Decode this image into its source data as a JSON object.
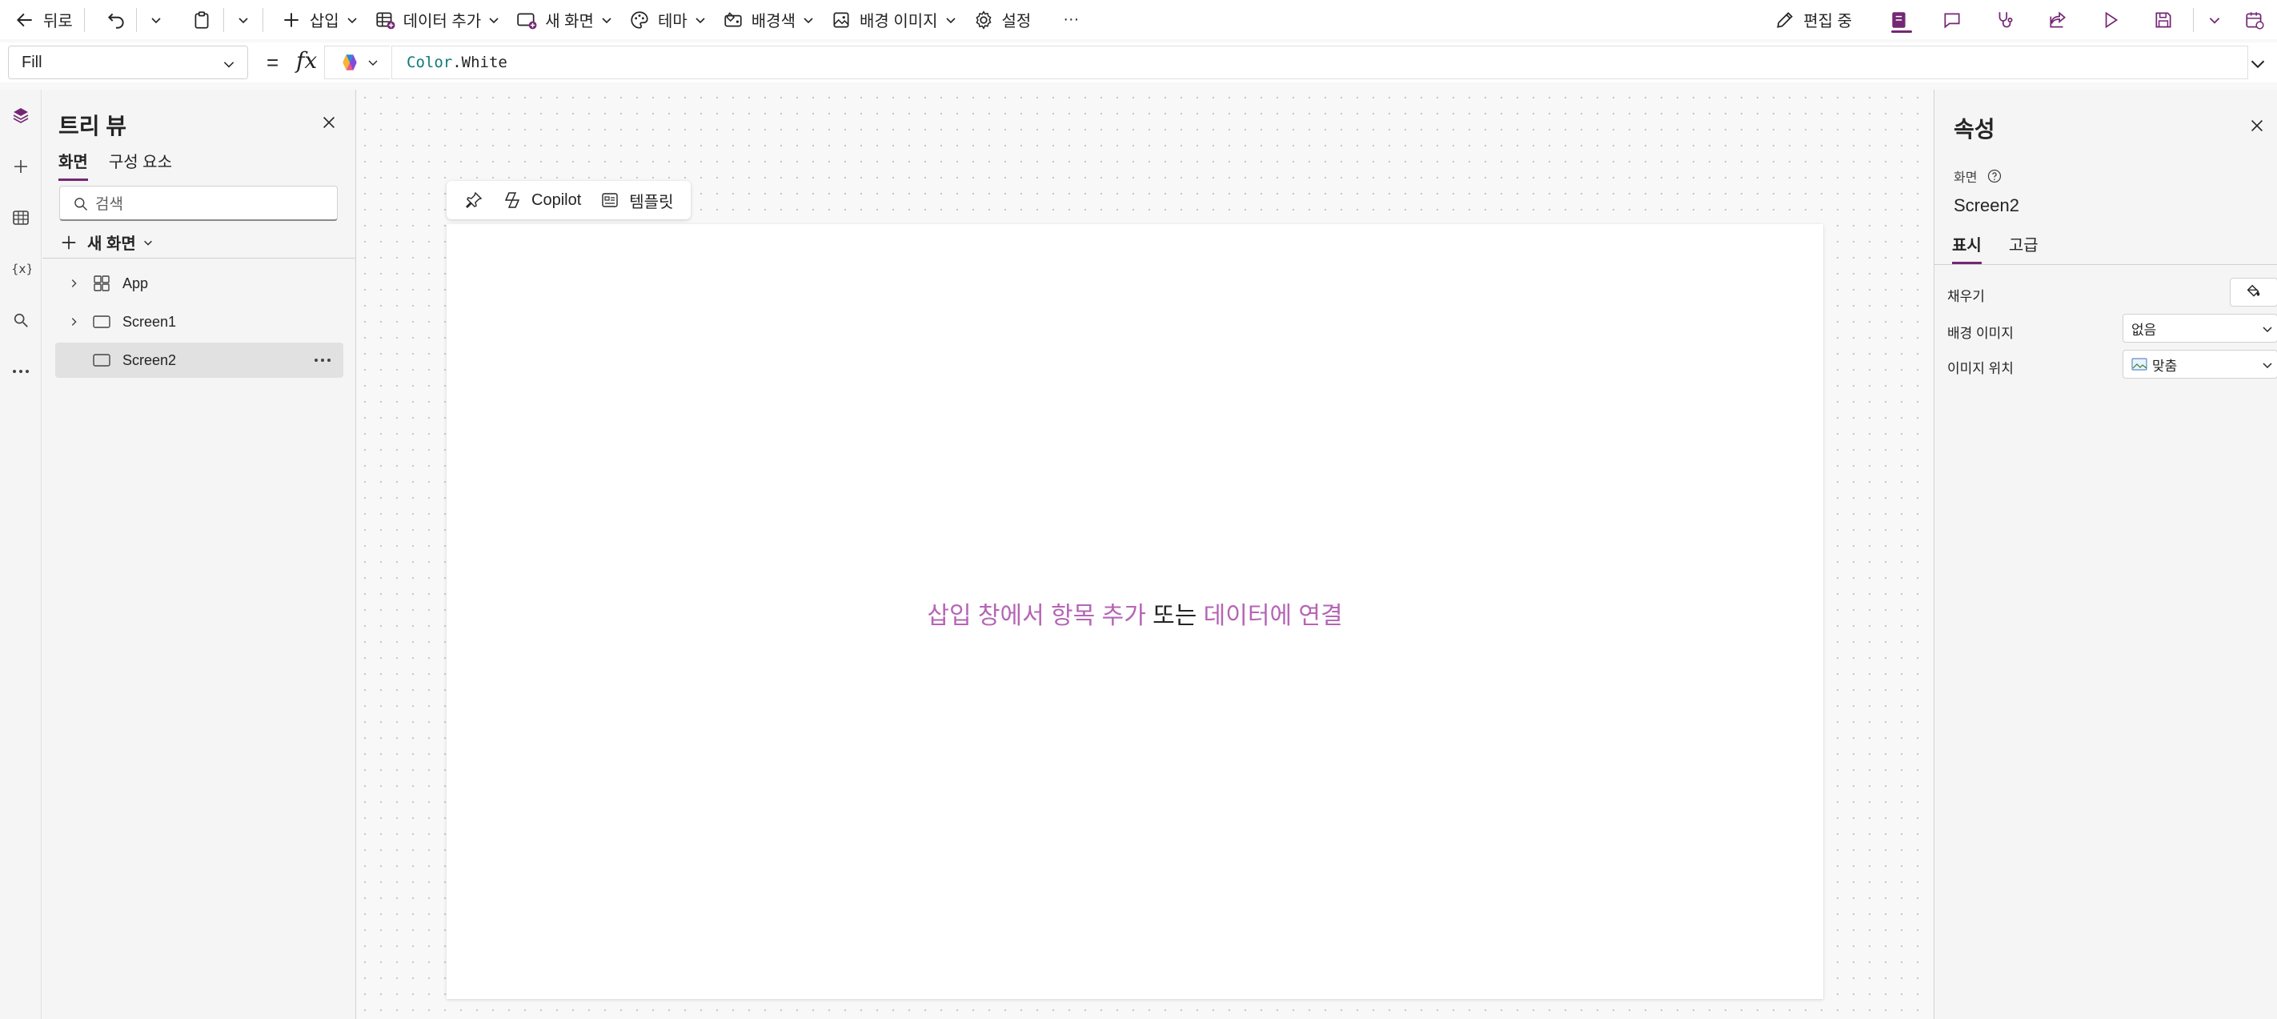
{
  "toolbar": {
    "back": "뒤로",
    "insert": "삽입",
    "add_data": "데이터 추가",
    "new_screen": "새 화면",
    "theme": "테마",
    "background_color": "배경색",
    "background_image": "배경 이미지",
    "settings": "설정",
    "more": "···",
    "editing": "편집 중"
  },
  "formula_bar": {
    "property": "Fill",
    "equals": "=",
    "fx": "fx",
    "formula_object": "Color",
    "formula_member": ".White"
  },
  "tree_view": {
    "title": "트리 뷰",
    "tabs": [
      "화면",
      "구성 요소"
    ],
    "search_placeholder": "검색",
    "new_screen": "새 화면",
    "items": [
      {
        "label": "App"
      },
      {
        "label": "Screen1"
      },
      {
        "label": "Screen2"
      }
    ]
  },
  "canvas": {
    "floating": {
      "copilot": "Copilot",
      "template": "템플릿"
    },
    "placeholder": {
      "part1": "삽입 창에서 항목 추가",
      "part2": " 또는 ",
      "part3": "데이터에 연결"
    }
  },
  "properties": {
    "title": "속성",
    "type": "화면",
    "name": "Screen2",
    "tabs": [
      "표시",
      "고급"
    ],
    "fill_label": "채우기",
    "bg_image_label": "배경 이미지",
    "bg_image_value": "없음",
    "image_position_label": "이미지 위치",
    "image_position_value": "맞춤"
  },
  "colors": {
    "accent": "#742774",
    "link": "#b565b5",
    "formula_keyword": "#0f7a7a"
  }
}
